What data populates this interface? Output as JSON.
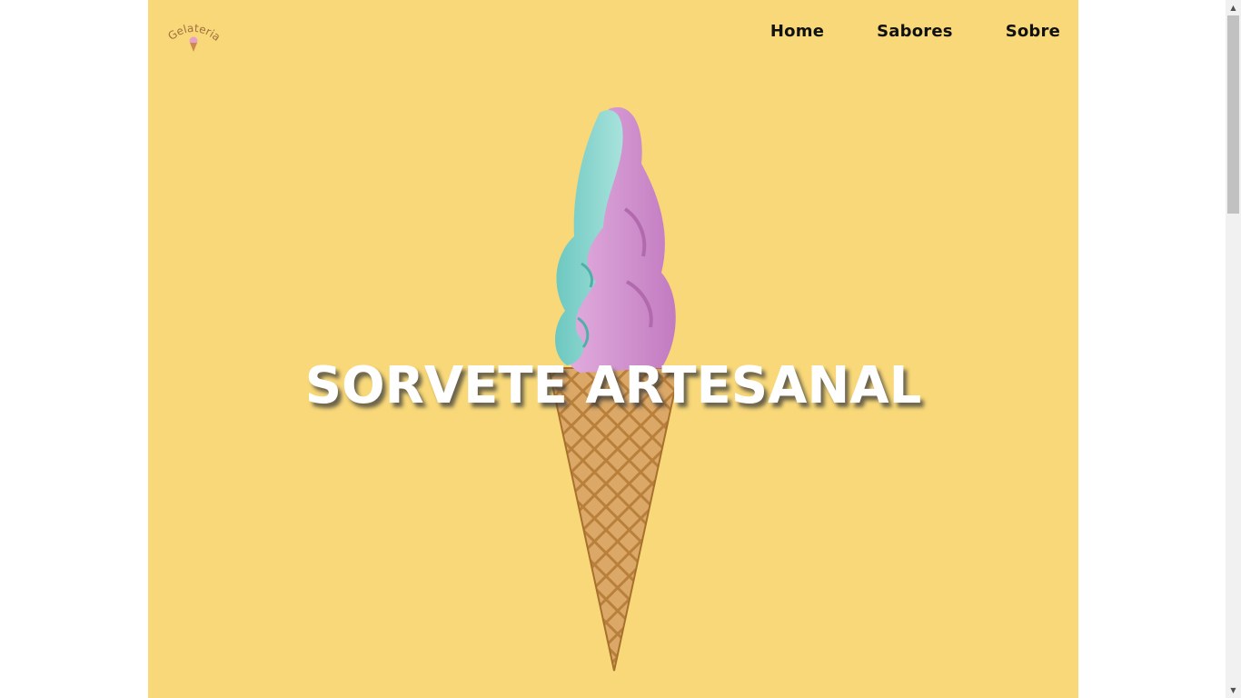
{
  "brand": {
    "logo_text": "Gelateria",
    "logo_icon": "ice-cream-icon"
  },
  "nav": {
    "items": [
      {
        "label": "Home"
      },
      {
        "label": "Sabores"
      },
      {
        "label": "Sobre"
      }
    ]
  },
  "hero": {
    "headline": "SORVETE ARTESANAL",
    "image": "ice-cream-cone-image"
  },
  "colors": {
    "hero_background": "#f8d878",
    "page_background": "#ffffff",
    "nav_text": "#111111",
    "headline_text": "#ffffff",
    "scoop_teal": "#8fd7d0",
    "scoop_pink": "#d9a0d6",
    "cone": "#d9a864"
  },
  "scrollbar": {
    "up_icon": "scroll-up-arrow-icon",
    "down_icon": "scroll-down-arrow-icon"
  }
}
